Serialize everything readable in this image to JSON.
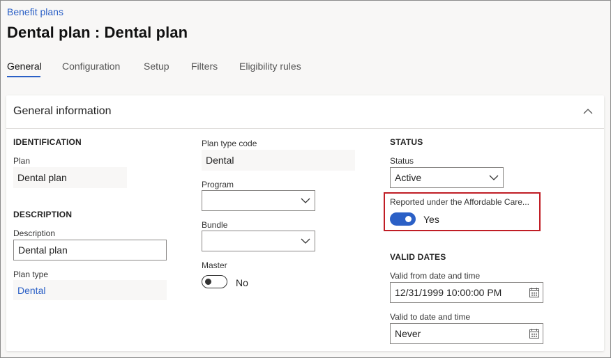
{
  "breadcrumb": "Benefit plans",
  "title": "Dental plan : Dental plan",
  "tabs": [
    {
      "label": "General",
      "active": true
    },
    {
      "label": "Configuration",
      "active": false
    },
    {
      "label": "Setup",
      "active": false
    },
    {
      "label": "Filters",
      "active": false
    },
    {
      "label": "Eligibility rules",
      "active": false
    }
  ],
  "section": {
    "title": "General information",
    "collapse_icon": "chevron-up-icon"
  },
  "identification": {
    "header": "IDENTIFICATION",
    "plan_label": "Plan",
    "plan_value": "Dental plan"
  },
  "description": {
    "header": "DESCRIPTION",
    "description_label": "Description",
    "description_value": "Dental plan",
    "plan_type_label": "Plan type",
    "plan_type_value": "Dental"
  },
  "plan_type_code": {
    "label": "Plan type code",
    "value": "Dental"
  },
  "program": {
    "label": "Program",
    "value": ""
  },
  "bundle": {
    "label": "Bundle",
    "value": ""
  },
  "master": {
    "label": "Master",
    "toggle_text": "No",
    "on": false
  },
  "status": {
    "header": "STATUS",
    "status_label": "Status",
    "status_value": "Active",
    "aca_label": "Reported under the Affordable Care...",
    "aca_toggle_text": "Yes",
    "aca_on": true,
    "highlight_color": "#c01d25"
  },
  "valid_dates": {
    "header": "VALID DATES",
    "from_label": "Valid from date and time",
    "from_value": "12/31/1999 10:00:00 PM",
    "to_label": "Valid to date and time",
    "to_value": "Never",
    "calendar_icon": "calendar-icon"
  },
  "colors": {
    "accent": "#2b60c6",
    "background": "#f8f7f6",
    "card": "#ffffff"
  }
}
